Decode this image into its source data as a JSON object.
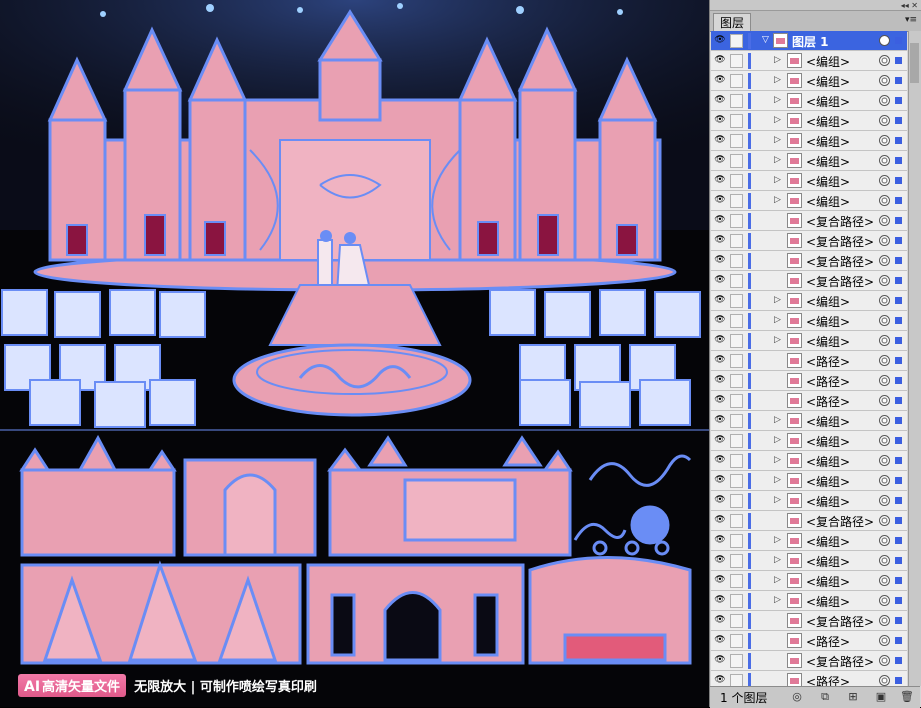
{
  "banner": {
    "badge_ai": "AI",
    "badge_text": "高清矢量文件",
    "text": "无限放大 | 可制作喷绘写真印刷"
  },
  "panel": {
    "tab": "图层",
    "footer_count": "1 个图层",
    "layers": [
      {
        "label": "图层 1",
        "selected": true,
        "expand": "down"
      },
      {
        "label": "<编组>",
        "expand": "right"
      },
      {
        "label": "<编组>",
        "expand": "right"
      },
      {
        "label": "<编组>",
        "expand": "right"
      },
      {
        "label": "<编组>",
        "expand": "right"
      },
      {
        "label": "<编组>",
        "expand": "right"
      },
      {
        "label": "<编组>",
        "expand": "right"
      },
      {
        "label": "<编组>",
        "expand": "right"
      },
      {
        "label": "<编组>",
        "expand": "right"
      },
      {
        "label": "<复合路径>",
        "expand": "none"
      },
      {
        "label": "<复合路径>",
        "expand": "none"
      },
      {
        "label": "<复合路径>",
        "expand": "none"
      },
      {
        "label": "<复合路径>",
        "expand": "none"
      },
      {
        "label": "<编组>",
        "expand": "right"
      },
      {
        "label": "<编组>",
        "expand": "right"
      },
      {
        "label": "<编组>",
        "expand": "right"
      },
      {
        "label": "<路径>",
        "expand": "none"
      },
      {
        "label": "<路径>",
        "expand": "none"
      },
      {
        "label": "<路径>",
        "expand": "none"
      },
      {
        "label": "<编组>",
        "expand": "right"
      },
      {
        "label": "<编组>",
        "expand": "right"
      },
      {
        "label": "<编组>",
        "expand": "right"
      },
      {
        "label": "<编组>",
        "expand": "right"
      },
      {
        "label": "<编组>",
        "expand": "right"
      },
      {
        "label": "<复合路径>",
        "expand": "none"
      },
      {
        "label": "<编组>",
        "expand": "right"
      },
      {
        "label": "<编组>",
        "expand": "right"
      },
      {
        "label": "<编组>",
        "expand": "right"
      },
      {
        "label": "<编组>",
        "expand": "right"
      },
      {
        "label": "<复合路径>",
        "expand": "none"
      },
      {
        "label": "<路径>",
        "expand": "none"
      },
      {
        "label": "<复合路径>",
        "expand": "none"
      },
      {
        "label": "<路径>",
        "expand": "none"
      }
    ]
  },
  "icons": {
    "visibility": "eye-icon",
    "expand_right": "triangle-right-icon",
    "expand_down": "triangle-down-icon",
    "target": "target-circle-icon",
    "selection": "selection-square-icon",
    "panel_menu": "menu-icon"
  },
  "colors": {
    "accent_blue": "#3b64e0",
    "artwork_blue": "#6a8df5",
    "artwork_pink": "#e9a0b2"
  }
}
